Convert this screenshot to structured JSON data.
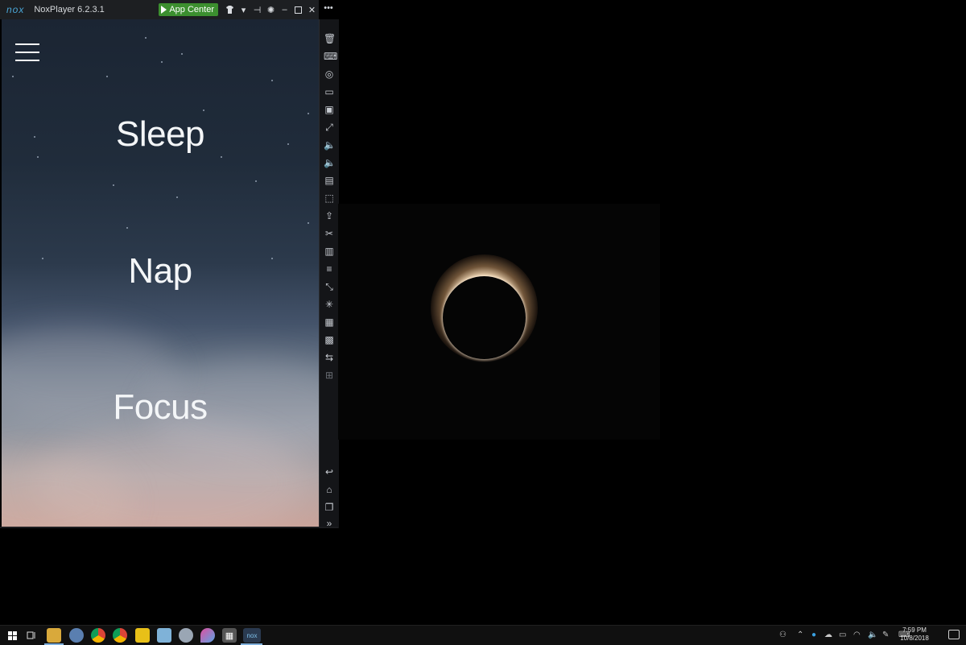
{
  "window": {
    "logo": "nox",
    "title": "NoxPlayer 6.2.3.1",
    "app_center_label": "App Center"
  },
  "sidebar_top": "•••",
  "app": {
    "modes": [
      "Sleep",
      "Nap",
      "Focus"
    ]
  },
  "sidebar": {
    "icons": [
      "trash",
      "keyboard",
      "location",
      "screen",
      "screenshot",
      "fullscreen",
      "volume-up",
      "volume-down",
      "toolbox",
      "apk-install",
      "import-export",
      "scissors",
      "multi-instance",
      "menu",
      "shake",
      "loading",
      "macro-recorder",
      "controller",
      "sync",
      "add",
      "back",
      "home",
      "recent-apps",
      "expand"
    ]
  },
  "taskbar": {
    "clock_time": "7:59 PM",
    "clock_date": "10/8/2018",
    "nox_label": "nox"
  }
}
